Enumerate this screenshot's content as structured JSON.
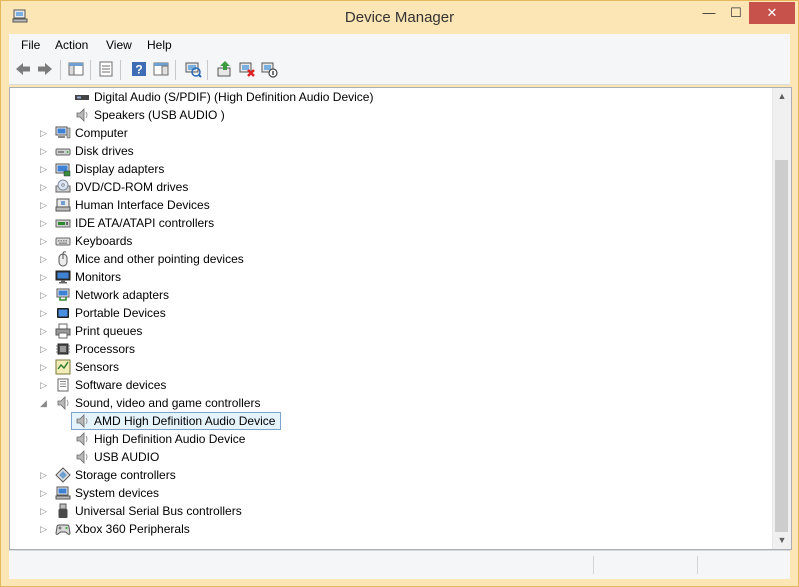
{
  "window": {
    "title": "Device Manager"
  },
  "controls": {
    "minimize": "—",
    "maximize": "☐",
    "close": "✕"
  },
  "menu": [
    "File",
    "Action",
    "View",
    "Help"
  ],
  "tree": [
    {
      "label": "Digital Audio (S/PDIF) (High Definition Audio Device)",
      "level": 2,
      "expander": "",
      "icon": "digital-audio-icon"
    },
    {
      "label": "Speakers (USB  AUDIO  )",
      "level": 2,
      "expander": "",
      "icon": "speaker-icon"
    },
    {
      "label": "Computer",
      "level": 1,
      "expander": "▷",
      "icon": "computer-icon"
    },
    {
      "label": "Disk drives",
      "level": 1,
      "expander": "▷",
      "icon": "disk-drive-icon"
    },
    {
      "label": "Display adapters",
      "level": 1,
      "expander": "▷",
      "icon": "display-adapter-icon"
    },
    {
      "label": "DVD/CD-ROM drives",
      "level": 1,
      "expander": "▷",
      "icon": "dvd-drive-icon"
    },
    {
      "label": "Human Interface Devices",
      "level": 1,
      "expander": "▷",
      "icon": "hid-icon"
    },
    {
      "label": "IDE ATA/ATAPI controllers",
      "level": 1,
      "expander": "▷",
      "icon": "ide-controller-icon"
    },
    {
      "label": "Keyboards",
      "level": 1,
      "expander": "▷",
      "icon": "keyboard-icon"
    },
    {
      "label": "Mice and other pointing devices",
      "level": 1,
      "expander": "▷",
      "icon": "mouse-icon"
    },
    {
      "label": "Monitors",
      "level": 1,
      "expander": "▷",
      "icon": "monitor-icon"
    },
    {
      "label": "Network adapters",
      "level": 1,
      "expander": "▷",
      "icon": "network-adapter-icon"
    },
    {
      "label": "Portable Devices",
      "level": 1,
      "expander": "▷",
      "icon": "portable-device-icon"
    },
    {
      "label": "Print queues",
      "level": 1,
      "expander": "▷",
      "icon": "printer-icon"
    },
    {
      "label": "Processors",
      "level": 1,
      "expander": "▷",
      "icon": "processor-icon"
    },
    {
      "label": "Sensors",
      "level": 1,
      "expander": "▷",
      "icon": "sensor-icon"
    },
    {
      "label": "Software devices",
      "level": 1,
      "expander": "▷",
      "icon": "software-device-icon"
    },
    {
      "label": "Sound, video and game controllers",
      "level": 1,
      "expander": "◢",
      "icon": "speaker-icon"
    },
    {
      "label": "AMD High Definition Audio Device",
      "level": 2,
      "expander": "",
      "icon": "speaker-icon",
      "selected": true
    },
    {
      "label": "High Definition Audio Device",
      "level": 2,
      "expander": "",
      "icon": "speaker-icon"
    },
    {
      "label": "USB  AUDIO",
      "level": 2,
      "expander": "",
      "icon": "speaker-icon"
    },
    {
      "label": "Storage controllers",
      "level": 1,
      "expander": "▷",
      "icon": "storage-controller-icon"
    },
    {
      "label": "System devices",
      "level": 1,
      "expander": "▷",
      "icon": "system-device-icon"
    },
    {
      "label": "Universal Serial Bus controllers",
      "level": 1,
      "expander": "▷",
      "icon": "usb-icon"
    },
    {
      "label": "Xbox 360 Peripherals",
      "level": 1,
      "expander": "▷",
      "icon": "gamepad-icon"
    }
  ],
  "scrollbar": {
    "up": "▲",
    "down": "▼",
    "position": 0.85
  }
}
